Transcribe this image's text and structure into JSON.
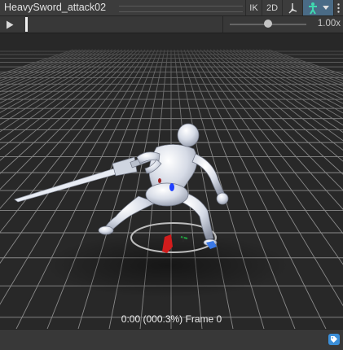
{
  "window": {
    "title": "HeavySword_attack02",
    "ik_label": "IK",
    "mode_2d_label": "2D",
    "pivot_icon": "pivot-icon",
    "avatar_icon": "avatar-preview-icon",
    "dropdown_icon": "chevron-down-icon",
    "menu_icon": "kebab-menu-icon"
  },
  "playback": {
    "play_icon": "play-icon",
    "speed_label": "1.00x",
    "speed_slider_fraction": 0.5
  },
  "viewport": {
    "frame_label": "0:00 (000.3%) Frame 0",
    "subject": "humanoid-model-with-sword"
  },
  "footer": {
    "tag_icon": "tag-icon"
  },
  "colors": {
    "accent": "#4a6b86",
    "tag_button": "#3b8fd9",
    "grid_line": "#8a8a8a",
    "background": "#282828"
  }
}
